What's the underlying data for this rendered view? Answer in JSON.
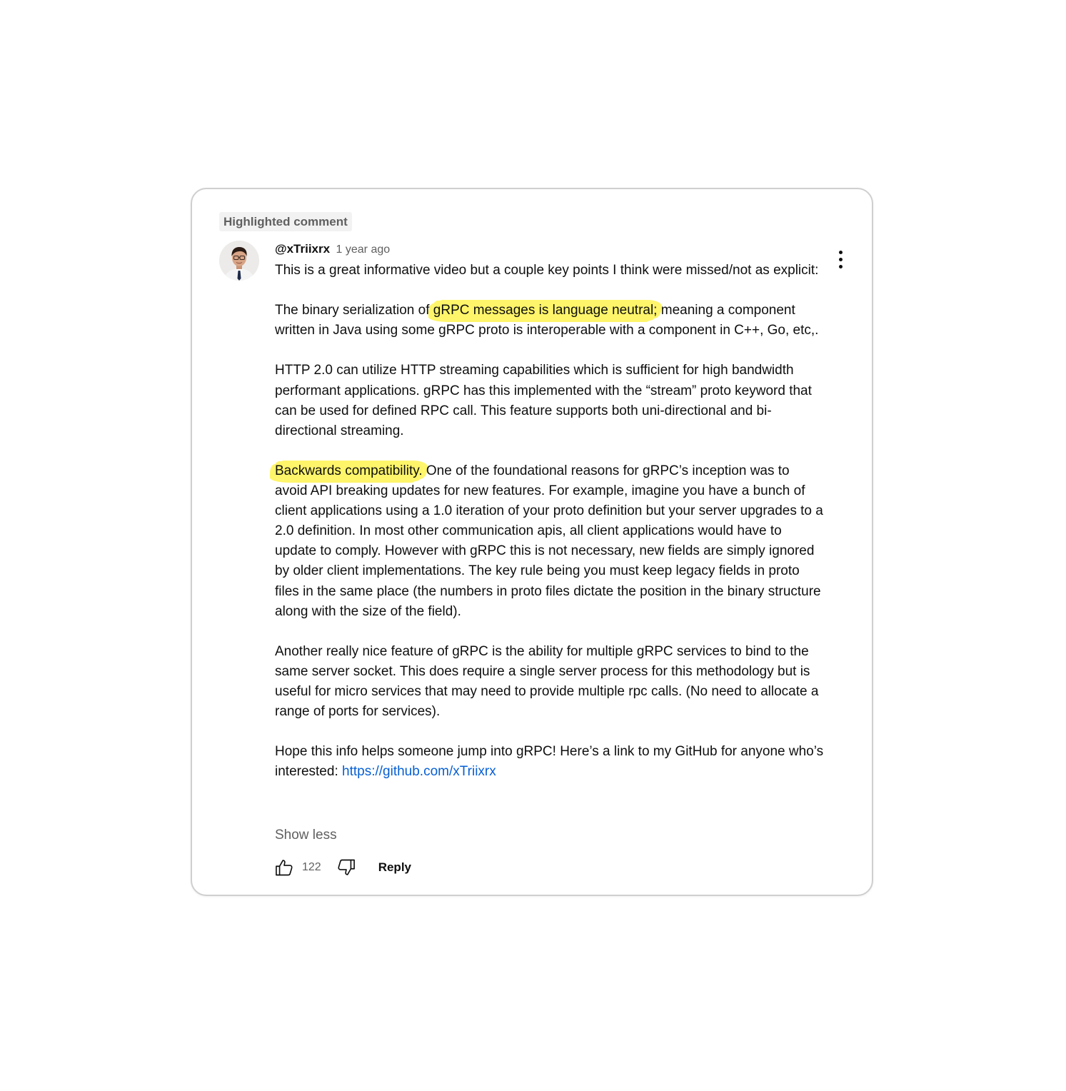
{
  "comment": {
    "badge": "Highlighted comment",
    "author": "@xTriixrx",
    "time": "1 year ago",
    "avatar_icon": "person-avatar-icon",
    "menu_icon": "more-vertical-icon",
    "paragraphs": {
      "p1": "This is a great informative video but a couple key points I think were missed/not as explicit:",
      "p2_before": "The binary serialization of ",
      "p2_highlight": "gRPC messages is language neutral;",
      "p2_after": " meaning a component written in Java using some gRPC proto is interoperable with a component in C++, Go, etc,.",
      "p3": "HTTP 2.0 can utilize HTTP streaming capabilities which is sufficient for high bandwidth performant applications. gRPC has this implemented with the “stream” proto keyword that can be used for defined RPC call. This feature supports both uni-directional and bi-directional streaming.",
      "p4_highlight": "Backwards compatibility.",
      "p4_after": " One of the foundational reasons for gRPC’s inception was to avoid API breaking updates for new features. For example, imagine you have a bunch of client applications using a 1.0 iteration of your proto definition but your server upgrades to a 2.0 definition. In most other communication apis, all client applications would have to update to comply. However with gRPC this is not necessary, new fields are simply ignored by older client implementations. The key rule being you must keep legacy fields in proto files in the same place (the numbers in proto files dictate the position in the binary structure along with the size of the field).",
      "p5": "Another really nice feature of gRPC is the ability for multiple gRPC services to bind to the same server socket. This does require a single server process for this methodology but is useful for micro services that may need to provide multiple rpc calls. (No need to allocate a range of ports for services).",
      "p6_before": "Hope this info helps someone jump into gRPC! Here’s a link to my GitHub for anyone who’s interested: ",
      "p6_link": "https://github.com/xTriixrx"
    },
    "show_less": "Show less",
    "likes": "122",
    "like_icon": "thumbs-up-icon",
    "dislike_icon": "thumbs-down-icon",
    "reply_label": "Reply"
  },
  "colors": {
    "highlight": "#fff56a",
    "link": "#065fd4",
    "secondary_text": "#606060",
    "card_border": "#cfcfcf"
  }
}
